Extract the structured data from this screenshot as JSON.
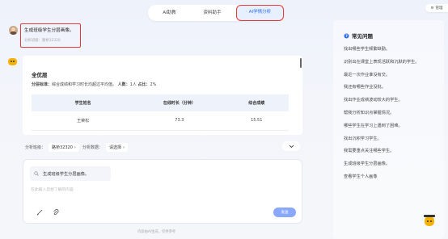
{
  "tabs": [
    {
      "label": "AI助教",
      "active": false
    },
    {
      "label": "资料助手",
      "active": false
    },
    {
      "label": "AI学情分析",
      "active": true
    }
  ],
  "top_right": {
    "manage_label": "管理"
  },
  "user_message": {
    "question": "生成班级学生分层画像。",
    "source": "分析班级：路桥32320"
  },
  "answer": {
    "heading": "全优层",
    "standard_label": "分层标准：",
    "standard_text": "综合成绩和学习时长均超过平均值。",
    "count_label": "人数：",
    "count_value": "1人",
    "ratio_label": "占比：",
    "ratio_value": "2%",
    "table": {
      "headers": [
        "学生姓名",
        "在线时长（分钟）",
        "综合成绩"
      ],
      "rows": [
        [
          "王荣松",
          "73.3",
          "15.51"
        ]
      ]
    }
  },
  "filters": {
    "class_label": "分析班级：",
    "class_value": "路桥32320",
    "data_label": "分析数据：",
    "data_value": "请选择"
  },
  "input": {
    "suggestion": "生成班级学生分层画像。",
    "placeholder": "在此输入您想了解的内容",
    "send_label": "发送"
  },
  "footer_note": "内容由AI生成，仅供参考",
  "faq": {
    "title": "常见问题",
    "items": [
      "找出哪些学生频繁缺勤。",
      "识别出在课堂上表现活跃和沉默的学生。",
      "最近一次作业谁没有交。",
      "我还有哪些作业没批。",
      "找出作业成绩波动较大的学生。",
      "帮我分析知识点掌握情况。",
      "哪些学生在学习上遇到了困难。",
      "找出沉积学习学生。",
      "我需要重点关注哪些学生。",
      "生成班级学生分层画像。",
      "查看学生个人画像"
    ]
  },
  "colors": {
    "accent": "#2f6df6",
    "highlight_border": "#e53935",
    "send": "#8aa8ff"
  }
}
